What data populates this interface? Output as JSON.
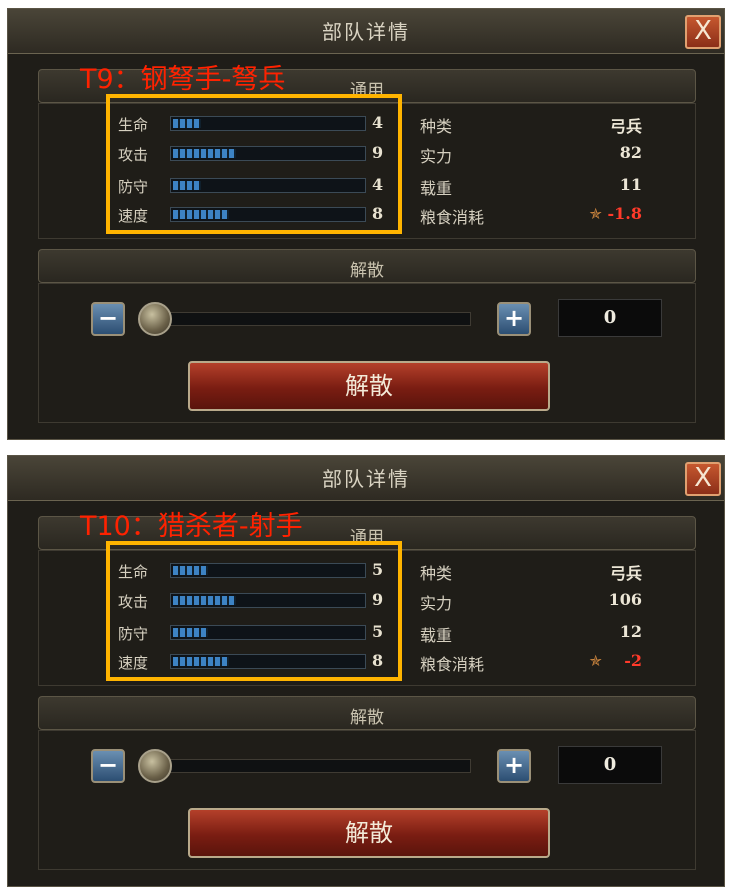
{
  "panels": [
    {
      "overlay": "T9：钢弩手-弩兵",
      "title": "部队详情",
      "close": "X",
      "section_general": "通用",
      "section_disband": "解散",
      "stats": [
        {
          "label": "生命",
          "value": "4",
          "level": 4
        },
        {
          "label": "攻击",
          "value": "9",
          "level": 9
        },
        {
          "label": "防守",
          "value": "4",
          "level": 4
        },
        {
          "label": "速度",
          "value": "8",
          "level": 8
        }
      ],
      "info": [
        {
          "label": "种类",
          "value": "弓兵"
        },
        {
          "label": "实力",
          "value": "82"
        },
        {
          "label": "载重",
          "value": "11"
        },
        {
          "label": "粮食消耗",
          "value": "-1.8"
        }
      ],
      "minus": "−",
      "plus": "+",
      "count": "0",
      "disband_button": "解散"
    },
    {
      "overlay": "T10：猎杀者-射手",
      "title": "部队详情",
      "close": "X",
      "section_general": "通用",
      "section_disband": "解散",
      "stats": [
        {
          "label": "生命",
          "value": "5",
          "level": 5
        },
        {
          "label": "攻击",
          "value": "9",
          "level": 9
        },
        {
          "label": "防守",
          "value": "5",
          "level": 5
        },
        {
          "label": "速度",
          "value": "8",
          "level": 8
        }
      ],
      "info": [
        {
          "label": "种类",
          "value": "弓兵"
        },
        {
          "label": "实力",
          "value": "106"
        },
        {
          "label": "载重",
          "value": "12"
        },
        {
          "label": "粮食消耗",
          "value": "-2"
        }
      ],
      "minus": "−",
      "plus": "+",
      "count": "0",
      "disband_button": "解散"
    }
  ],
  "icons": {
    "feather": "feather-icon"
  },
  "colors": {
    "overlay": "#ff2200",
    "frame": "#ffb400",
    "food_cost": "#ff3a2a",
    "bar": "#3d83c4"
  }
}
